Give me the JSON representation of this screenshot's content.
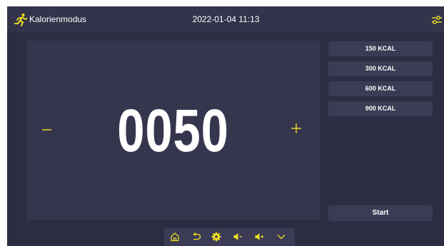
{
  "header": {
    "mode_title": "Kalorienmodus",
    "datetime": "2022-01-04 11:13",
    "mode_icon": "running-person-icon",
    "settings_icon": "sliders-icon"
  },
  "display": {
    "value": "0050",
    "decrease_icon": "minus-icon",
    "increase_icon": "plus-icon"
  },
  "presets": [
    "150 KCAL",
    "300 KCAL",
    "600 KCAL",
    "900 KCAL"
  ],
  "start_label": "Start",
  "bottom_bar": [
    "home-icon",
    "back-icon",
    "gear-icon",
    "volume-down-icon",
    "volume-up-icon",
    "chevron-down-icon"
  ],
  "colors": {
    "accent": "#f2e022",
    "background": "#2c2c42",
    "panel": "#35354e",
    "button": "#3b3b55"
  }
}
